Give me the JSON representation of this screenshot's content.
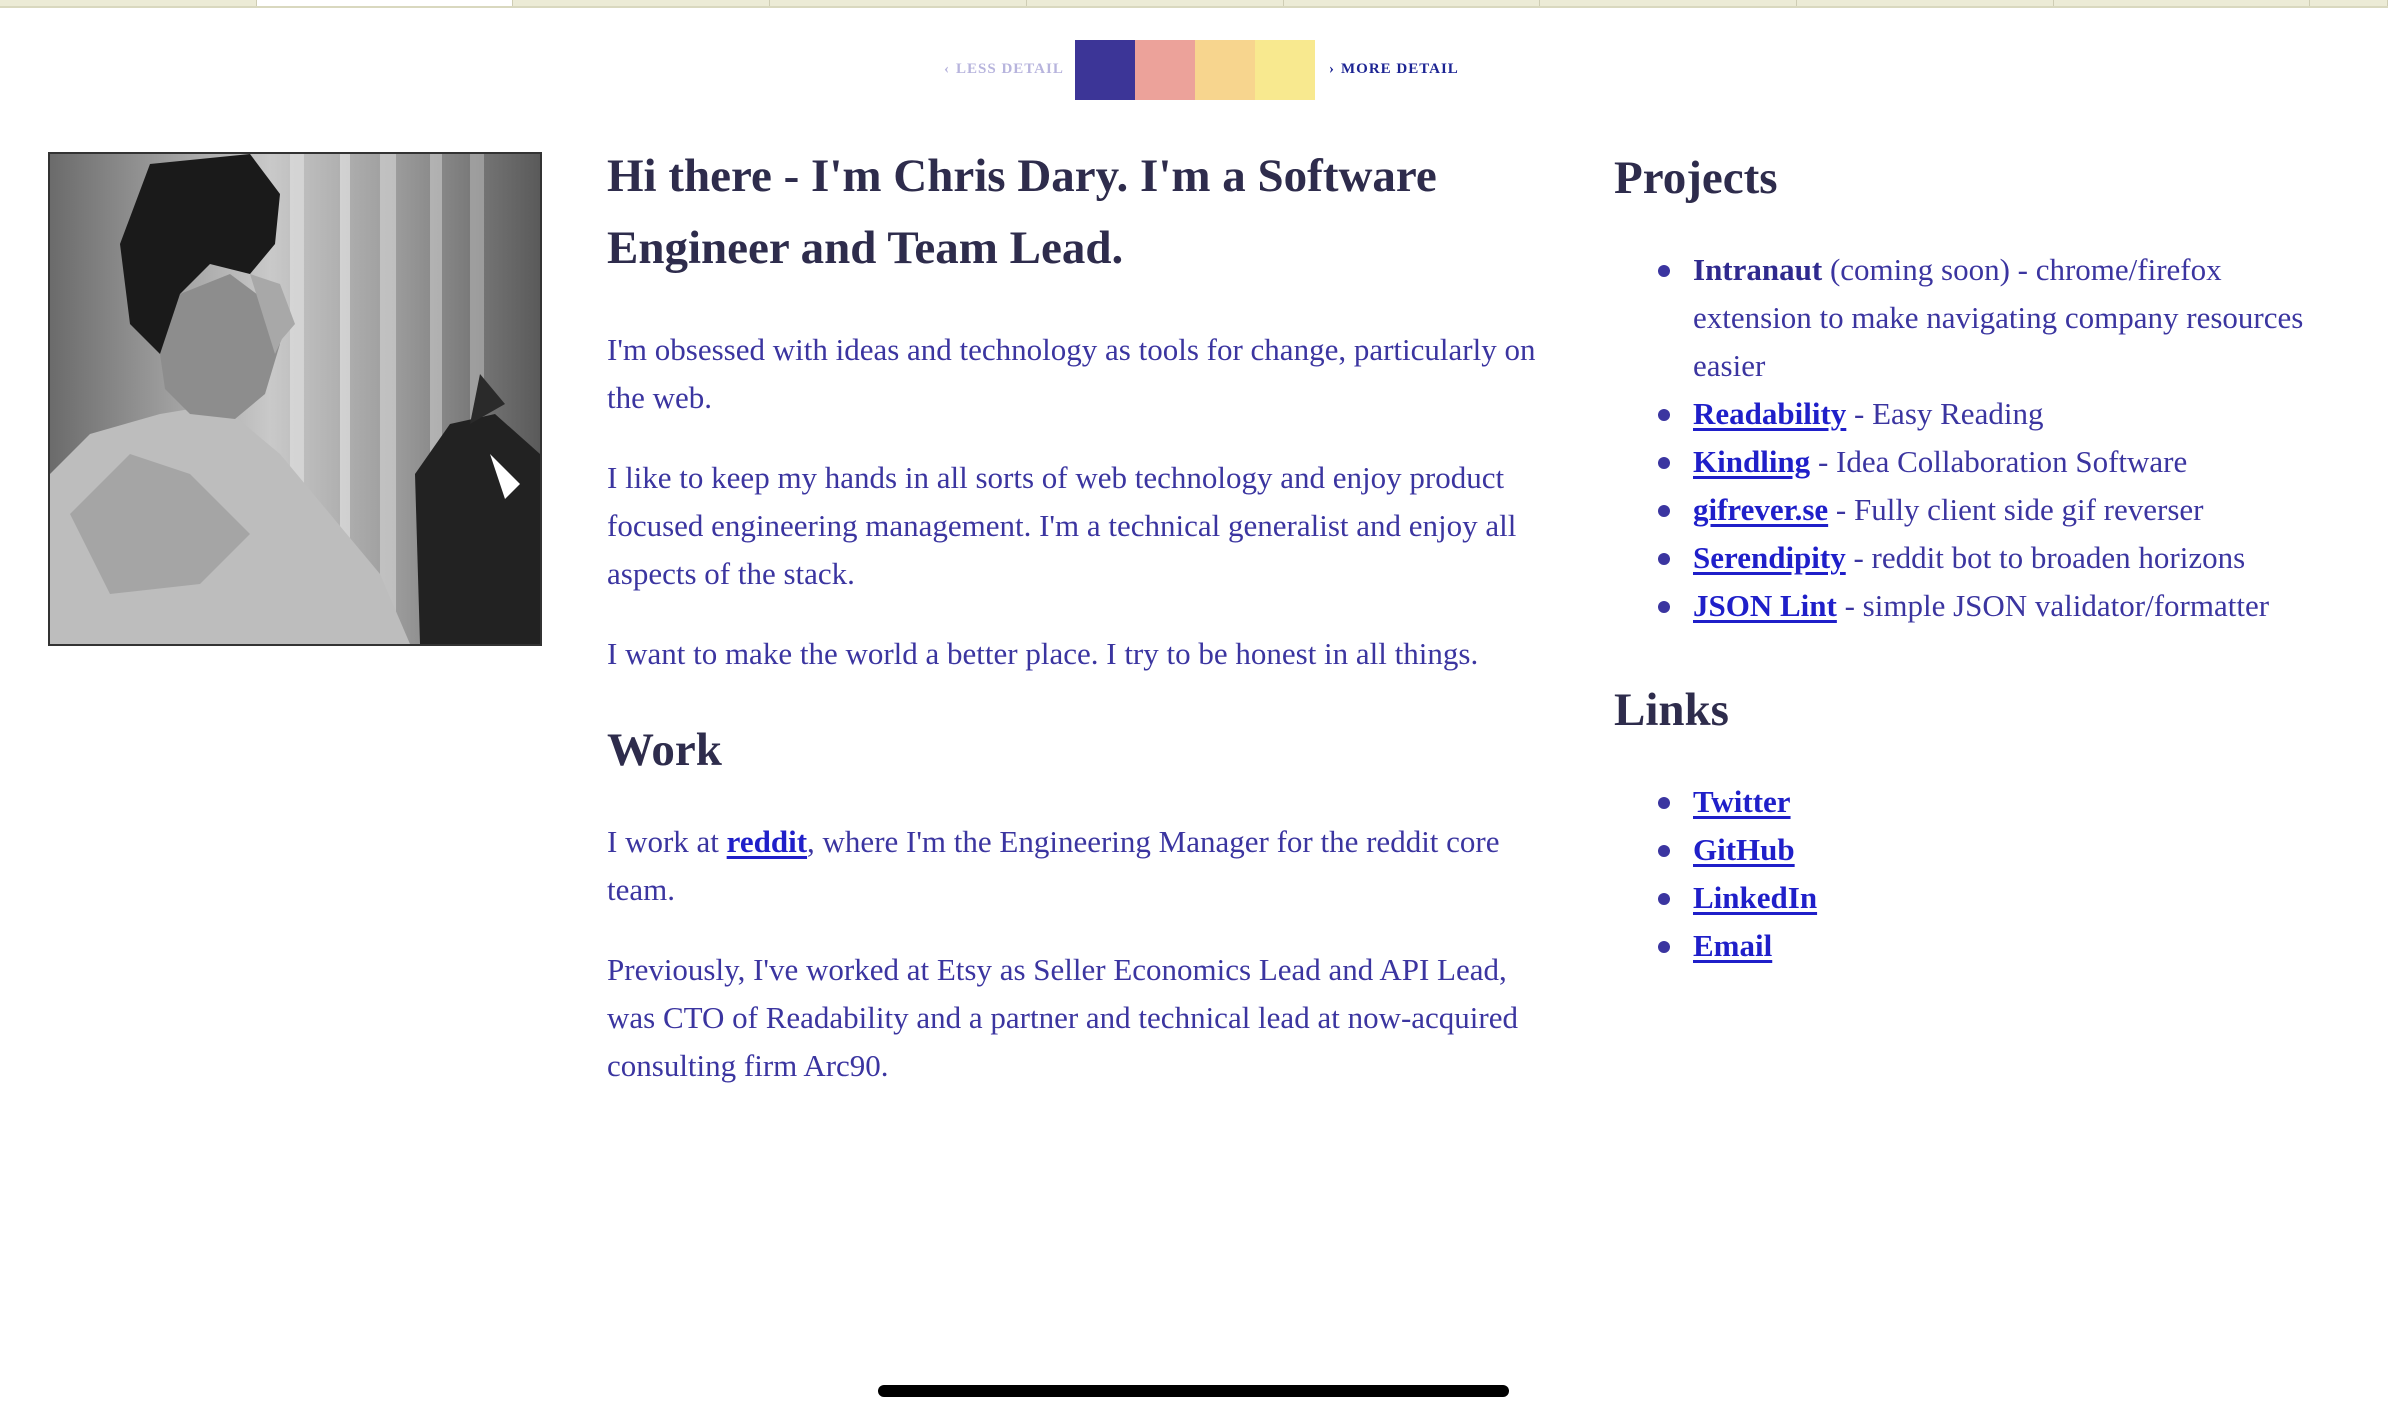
{
  "controls": {
    "less_detail": "LESS DETAIL",
    "more_detail": "MORE DETAIL",
    "chevron_left": "‹",
    "chevron_right": "›",
    "swatch_colors": [
      "#3c3597",
      "#eca29a",
      "#f7d58e",
      "#f8e98f"
    ]
  },
  "avatar": {
    "icon": "portrait-photo"
  },
  "intro": {
    "title": "Hi there - I'm Chris Dary. I'm a Software Engineer and Team Lead.",
    "paragraphs": [
      "I'm obsessed with ideas and technology as tools for change, particularly on the web.",
      "I like to keep my hands in all sorts of web technology and enjoy product focused engineering management. I'm a technical generalist and enjoy all aspects of the stack.",
      "I want to make the world a better place. I try to be honest in all things."
    ]
  },
  "work": {
    "heading": "Work",
    "p1_before": "I work at ",
    "p1_link": "reddit",
    "p1_after": ", where I'm the Engineering Manager for the reddit core team.",
    "p2": "Previously, I've worked at Etsy as Seller Economics Lead and API Lead, was CTO of Readability and a partner and technical lead at now-acquired consulting firm Arc90."
  },
  "projects": {
    "heading": "Projects",
    "items": [
      {
        "name": "Intranaut",
        "desc": " (coming soon) - chrome/firefox extension to make navigating company resources easier"
      },
      {
        "name": "Readability",
        "desc": " - Easy Reading"
      },
      {
        "name": "Kindling",
        "desc": " - Idea Collaboration Software"
      },
      {
        "name": "gifrever.se",
        "desc": " - Fully client side gif reverser"
      },
      {
        "name": "Serendipity",
        "desc": " - reddit bot to broaden horizons"
      },
      {
        "name": "JSON Lint",
        "desc": " - simple JSON validator/formatter"
      }
    ]
  },
  "links": {
    "heading": "Links",
    "items": [
      "Twitter",
      "GitHub",
      "LinkedIn",
      "Email"
    ]
  }
}
